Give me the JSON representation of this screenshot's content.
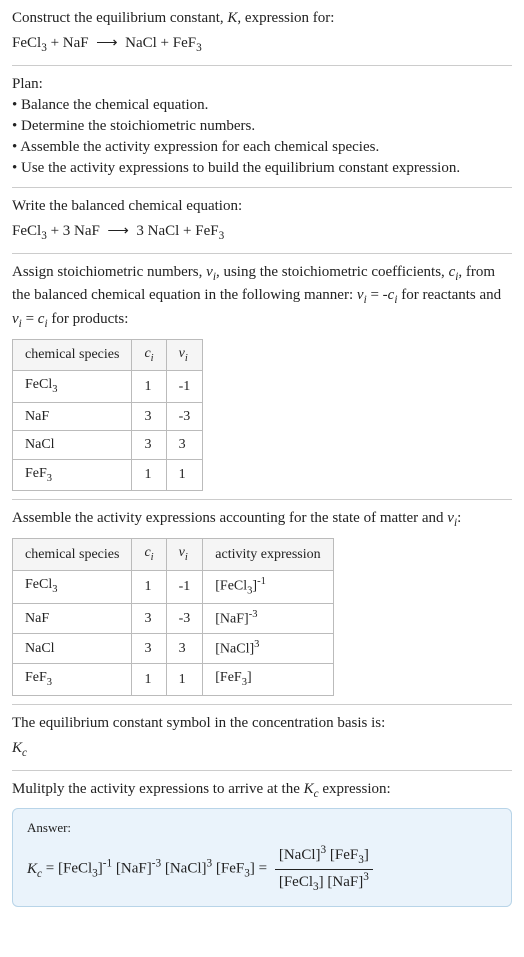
{
  "prompt": {
    "line1": "Construct the equilibrium constant, K, expression for:",
    "equation": "FeCl₃ + NaF ⟶ NaCl + FeF₃"
  },
  "plan": {
    "heading": "Plan:",
    "items": [
      "Balance the chemical equation.",
      "Determine the stoichiometric numbers.",
      "Assemble the activity expression for each chemical species.",
      "Use the activity expressions to build the equilibrium constant expression."
    ]
  },
  "balanced": {
    "heading": "Write the balanced chemical equation:",
    "equation": "FeCl₃ + 3 NaF ⟶ 3 NaCl + FeF₃"
  },
  "stoich": {
    "text": "Assign stoichiometric numbers, νᵢ, using the stoichiometric coefficients, cᵢ, from the balanced chemical equation in the following manner: νᵢ = -cᵢ for reactants and νᵢ = cᵢ for products:",
    "headers": [
      "chemical species",
      "cᵢ",
      "νᵢ"
    ],
    "rows": [
      [
        "FeCl₃",
        "1",
        "-1"
      ],
      [
        "NaF",
        "3",
        "-3"
      ],
      [
        "NaCl",
        "3",
        "3"
      ],
      [
        "FeF₃",
        "1",
        "1"
      ]
    ]
  },
  "activity": {
    "text": "Assemble the activity expressions accounting for the state of matter and νᵢ:",
    "headers": [
      "chemical species",
      "cᵢ",
      "νᵢ",
      "activity expression"
    ],
    "rows": [
      [
        "FeCl₃",
        "1",
        "-1",
        "[FeCl₃]⁻¹"
      ],
      [
        "NaF",
        "3",
        "-3",
        "[NaF]⁻³"
      ],
      [
        "NaCl",
        "3",
        "3",
        "[NaCl]³"
      ],
      [
        "FeF₃",
        "1",
        "1",
        "[FeF₃]"
      ]
    ]
  },
  "symbol": {
    "text": "The equilibrium constant symbol in the concentration basis is:",
    "value": "K_c"
  },
  "multiply": {
    "text": "Mulitply the activity expressions to arrive at the K_c expression:"
  },
  "answer": {
    "label": "Answer:",
    "lhs": "K_c = [FeCl₃]⁻¹ [NaF]⁻³ [NaCl]³ [FeF₃] =",
    "num": "[NaCl]³ [FeF₃]",
    "den": "[FeCl₃] [NaF]³"
  }
}
